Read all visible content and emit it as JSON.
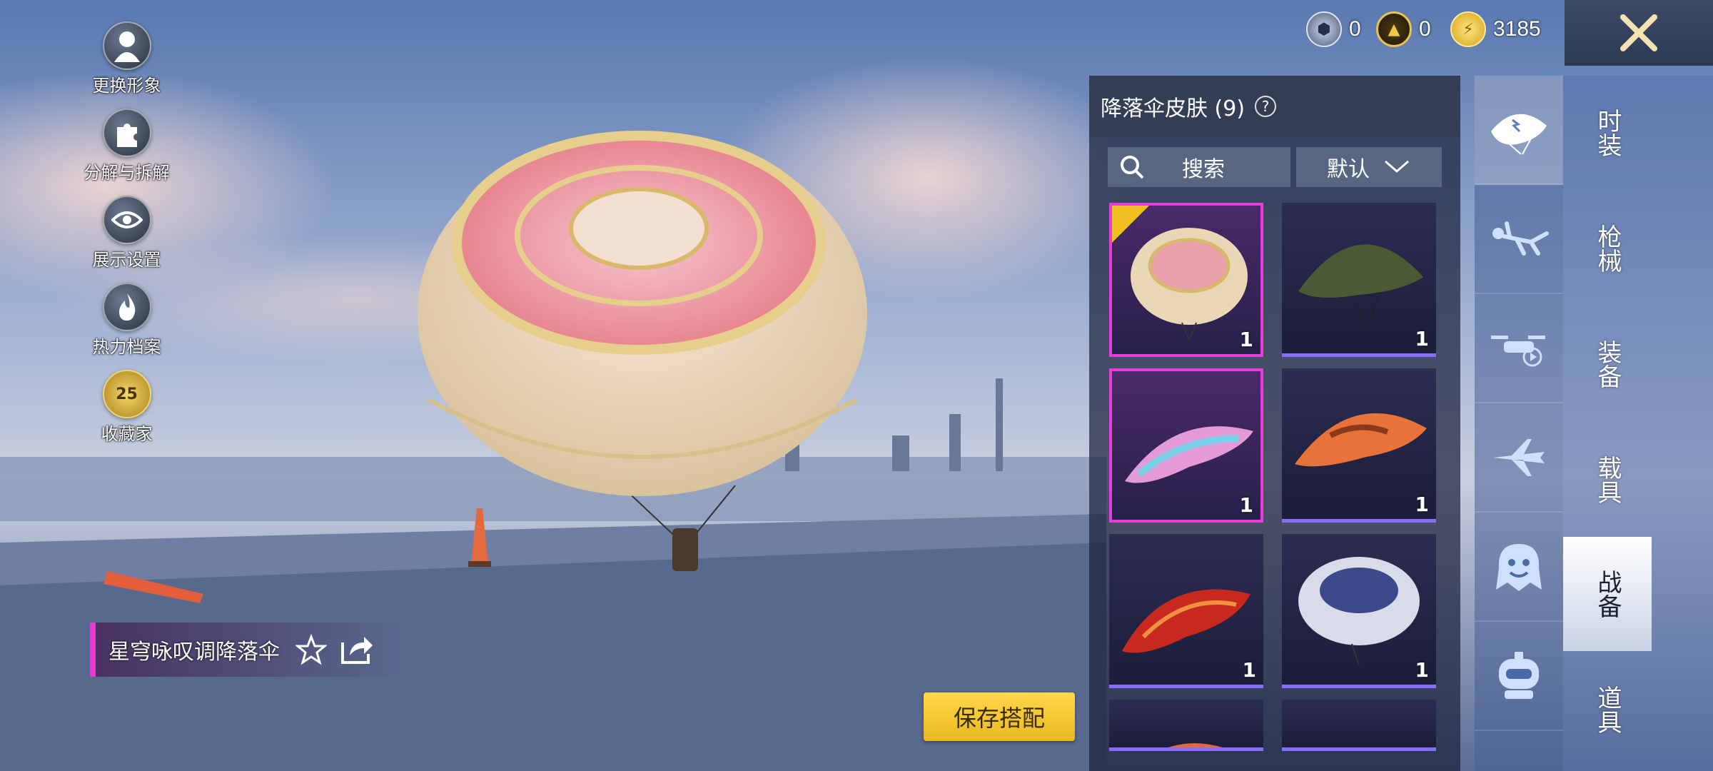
{
  "currency": [
    {
      "name": "crystal-icon",
      "value": "0"
    },
    {
      "name": "gold-badge-icon",
      "value": "0"
    },
    {
      "name": "bp-coin-icon",
      "value": "3185"
    }
  ],
  "left_menu": [
    {
      "label": "更换形象",
      "icon": "avatar-icon"
    },
    {
      "label": "分解与拆解",
      "icon": "puzzle-icon"
    },
    {
      "label": "展示设置",
      "icon": "eye-icon"
    },
    {
      "label": "热力档案",
      "icon": "flame-icon"
    },
    {
      "label": "收藏家",
      "icon": "collector-badge-icon",
      "badge": "25"
    }
  ],
  "panel": {
    "title": "降落伞皮肤 (9)",
    "search_label": "搜索",
    "sort_label": "默认",
    "items": [
      {
        "qty": "1",
        "selected": true,
        "color": "#e9d7b5"
      },
      {
        "qty": "1",
        "selected": false,
        "color": "#4b5a34"
      },
      {
        "qty": "1",
        "selected": false,
        "color": "#e59ad8"
      },
      {
        "qty": "1",
        "selected": false,
        "color": "#e8733a"
      },
      {
        "qty": "1",
        "selected": false,
        "color": "#c8281e"
      },
      {
        "qty": "1",
        "selected": false,
        "color": "#d8dce8"
      },
      {
        "qty": "",
        "selected": false,
        "color": "#e06a40"
      },
      {
        "qty": "",
        "selected": false,
        "color": "#2a2450"
      }
    ]
  },
  "category_icons": [
    "parachute-icon",
    "skydiver-icon",
    "drone-icon",
    "airplane-icon",
    "emote-icon",
    "robot-icon"
  ],
  "main_tabs": [
    {
      "label": "时装"
    },
    {
      "label": "枪械"
    },
    {
      "label": "装备"
    },
    {
      "label": "载具"
    },
    {
      "label": "战备",
      "active": true
    },
    {
      "label": "道具"
    }
  ],
  "item_name": "星穹咏叹调降落伞",
  "save_button": "保存搭配"
}
